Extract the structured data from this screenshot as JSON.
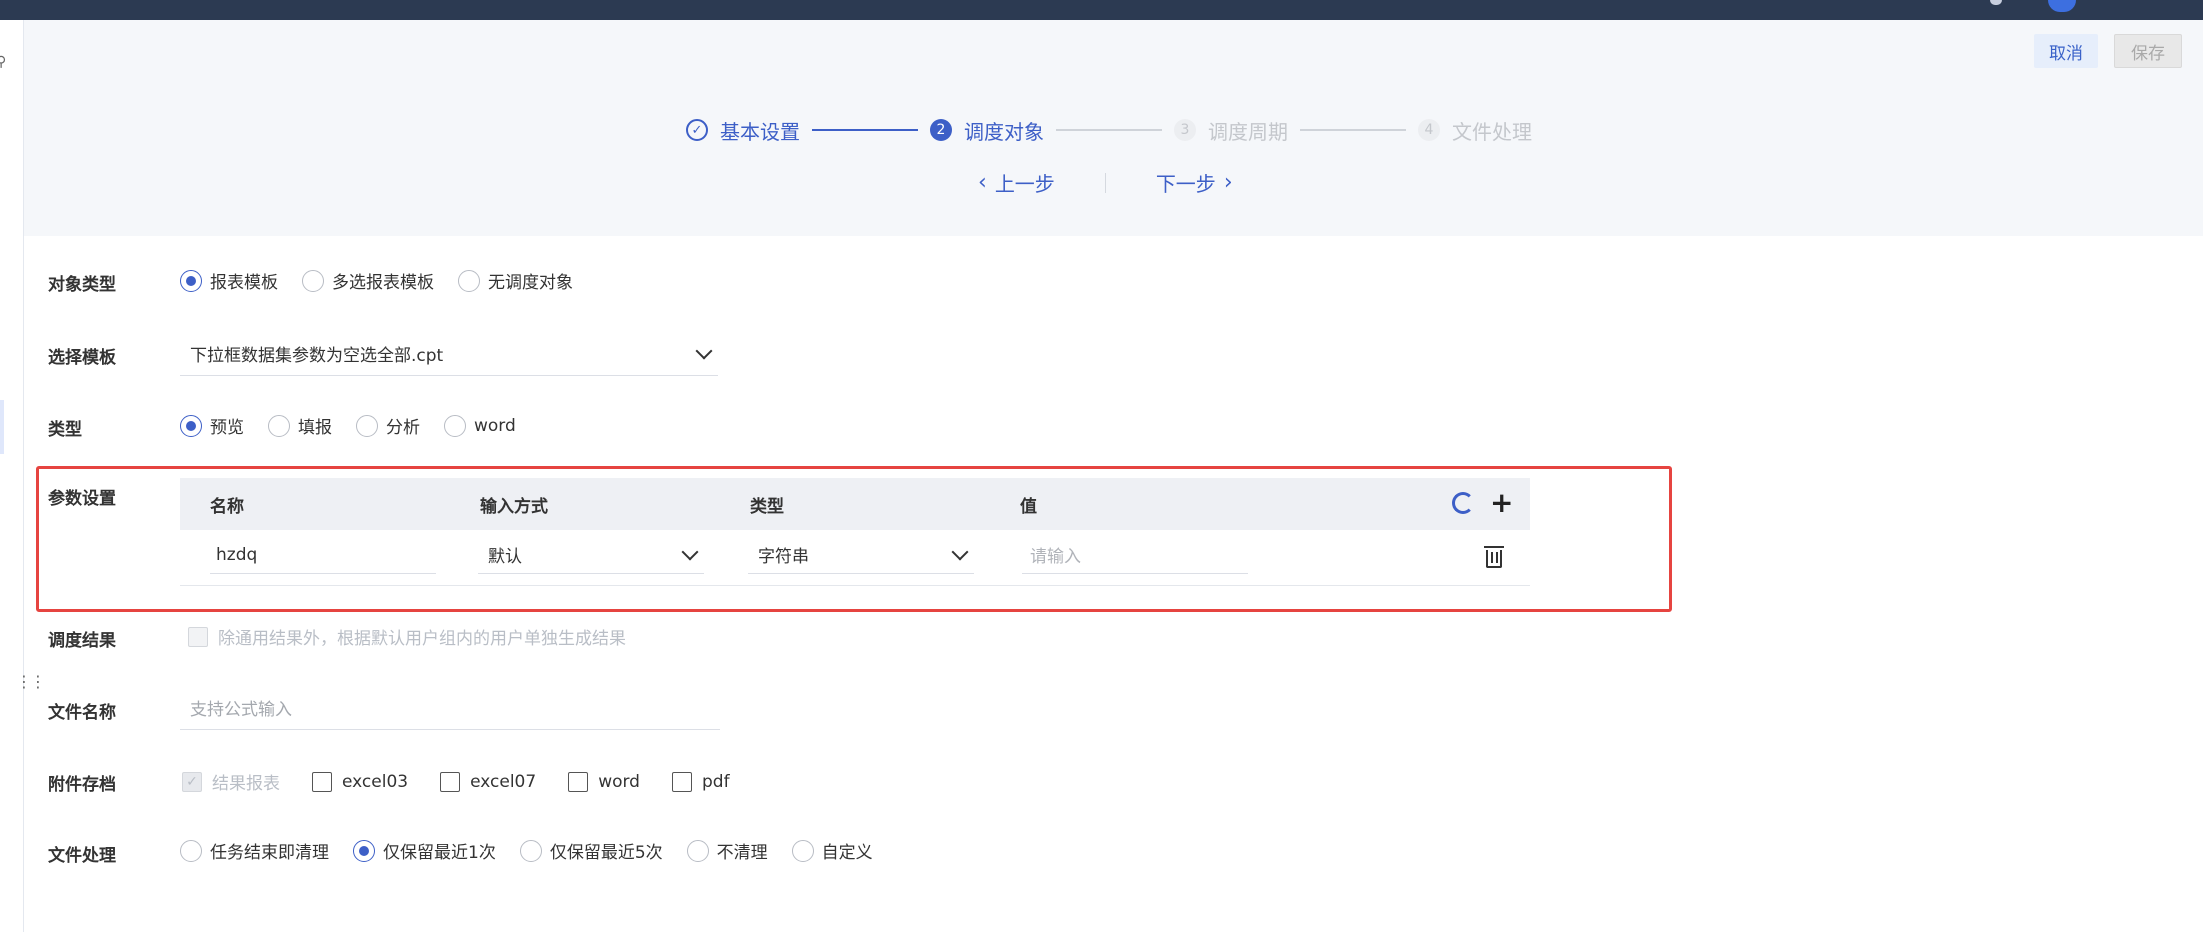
{
  "header": {
    "cancel_label": "取消",
    "save_label": "保存"
  },
  "steps": [
    {
      "num": "✓",
      "label": "基本设置",
      "state": "done"
    },
    {
      "num": "2",
      "label": "调度对象",
      "state": "active"
    },
    {
      "num": "3",
      "label": "调度周期",
      "state": "todo"
    },
    {
      "num": "4",
      "label": "文件处理",
      "state": "todo"
    }
  ],
  "nav": {
    "prev_label": "上一步",
    "next_label": "下一步"
  },
  "form": {
    "object_type": {
      "label": "对象类型",
      "options": [
        "报表模板",
        "多选报表模板",
        "无调度对象"
      ],
      "selected": "报表模板"
    },
    "template": {
      "label": "选择模板",
      "value": "下拉框数据集参数为空选全部.cpt"
    },
    "type": {
      "label": "类型",
      "options": [
        "预览",
        "填报",
        "分析",
        "word"
      ],
      "selected": "预览"
    },
    "params": {
      "label": "参数设置",
      "columns": [
        "名称",
        "输入方式",
        "类型",
        "值"
      ],
      "rows": [
        {
          "name": "hzdq",
          "input_mode": "默认",
          "type": "字符串",
          "value_placeholder": "请输入"
        }
      ]
    },
    "result": {
      "label": "调度结果",
      "checkbox_text": "除通用结果外，根据默认用户组内的用户单独生成结果"
    },
    "file_name": {
      "label": "文件名称",
      "placeholder": "支持公式输入"
    },
    "attachment": {
      "label": "附件存档",
      "options": [
        "结果报表",
        "excel03",
        "excel07",
        "word",
        "pdf"
      ]
    },
    "file_handling": {
      "label": "文件处理",
      "options": [
        "任务结束即清理",
        "仅保留最近1次",
        "仅保留最近5次",
        "不清理",
        "自定义"
      ],
      "selected": "仅保留最近1次"
    }
  }
}
